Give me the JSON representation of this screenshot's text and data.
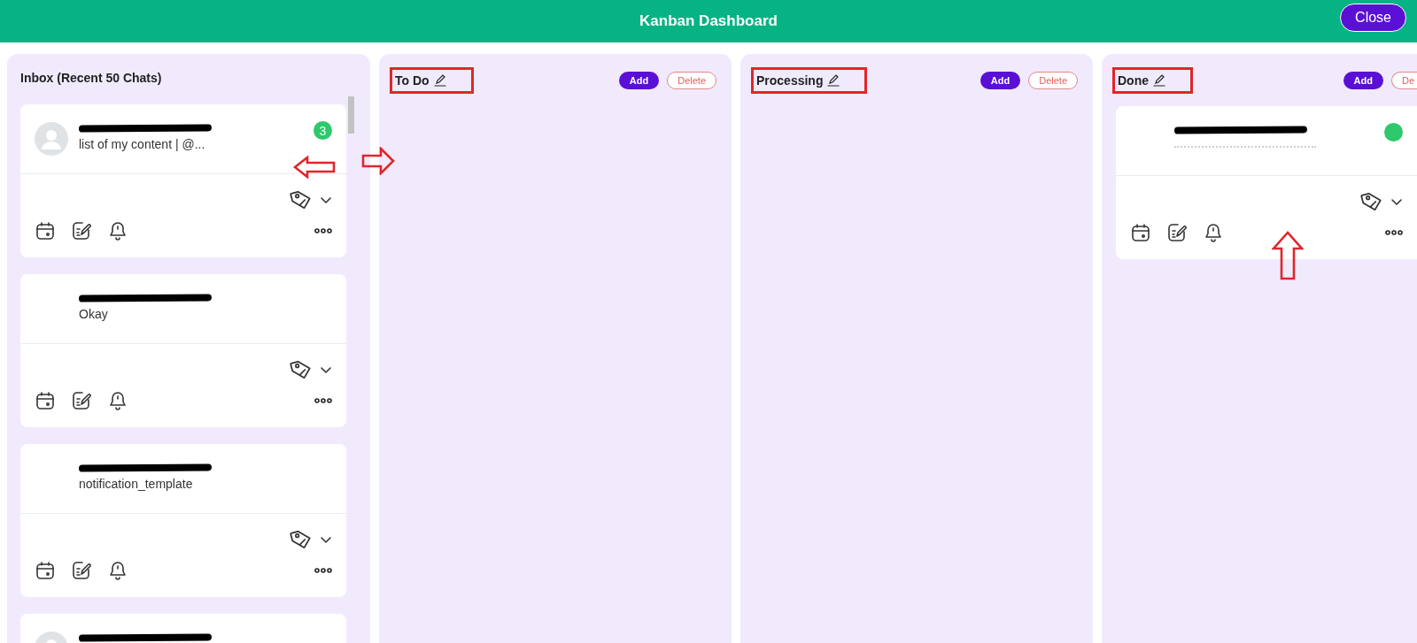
{
  "header": {
    "title": "Kanban Dashboard",
    "close_button": "Close"
  },
  "inbox": {
    "title": "Inbox (Recent 50 Chats)",
    "arrow_right": true,
    "cards": [
      {
        "avatar": true,
        "name_redacted": true,
        "preview": "list of my content | @...",
        "badge": true,
        "unread": "3",
        "arrow_left": true,
        "actions": true
      },
      {
        "avatar": false,
        "name_redacted": true,
        "preview": "Okay",
        "actions": true
      },
      {
        "avatar": false,
        "name_redacted": true,
        "preview": "notification_template",
        "actions": true
      },
      {
        "avatar": true,
        "name_redacted": true
      }
    ]
  },
  "columns": [
    {
      "title": "To Do",
      "highlighted": true,
      "add_button": "Add",
      "delete_button": "Delete"
    },
    {
      "title": "Processing",
      "highlighted": true,
      "add_button": "Add",
      "delete_button": "Delete"
    },
    {
      "title": "Done",
      "highlighted": true,
      "add_button": "Add",
      "delete_button": "De",
      "arrow_up": true,
      "cards": [
        {
          "avatar": false,
          "name_redacted": true,
          "preview_redacted": true,
          "badge": true,
          "actions": true
        }
      ]
    }
  ]
}
